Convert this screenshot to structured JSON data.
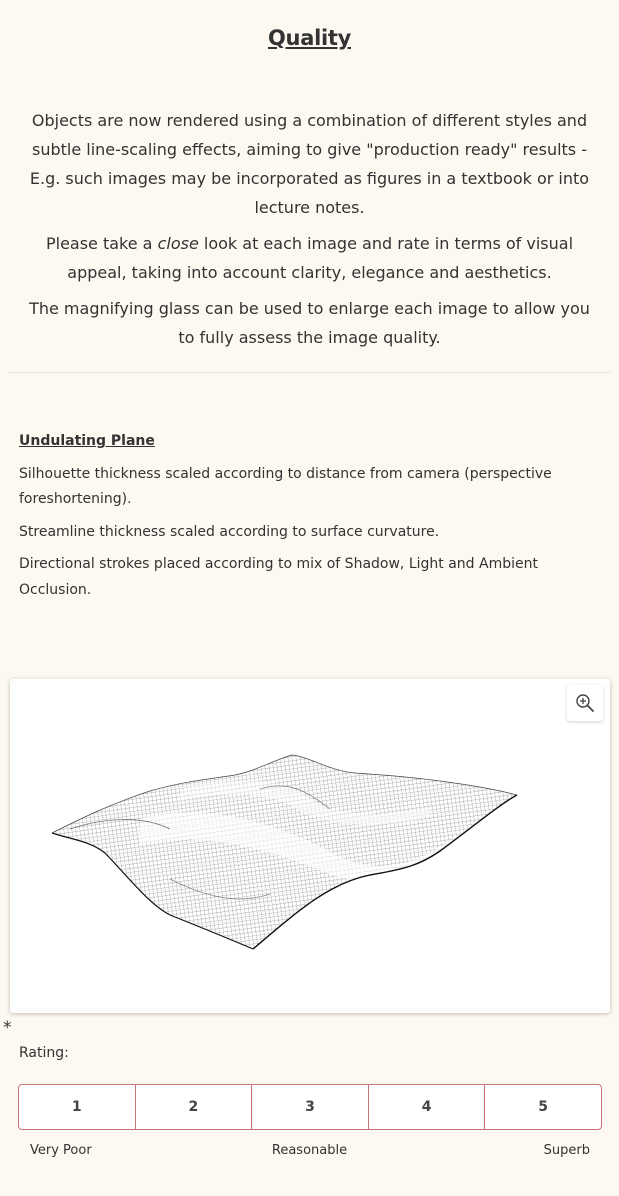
{
  "page": {
    "title": "Quality"
  },
  "intro": {
    "p1": "Objects are now rendered using a combination of different styles and subtle line-scaling effects, aiming to give \"production ready\" results - E.g. such images may be incorporated as figures in a textbook or into lecture notes.",
    "p2_before": "Please take a ",
    "p2_emphasis": "close",
    "p2_after": " look at each image and rate in terms of visual appeal, taking into account clarity, elegance and aesthetics.",
    "p3": "The magnifying glass can be used to enlarge each image to allow you to fully assess the image quality."
  },
  "section": {
    "title": "Undulating Plane",
    "lines": [
      "Silhouette thickness scaled according to distance from camera (perspective foreshortening).",
      "Streamline thickness scaled according to surface curvature.",
      "Directional strokes placed according to mix of Shadow, Light and Ambient Occlusion."
    ]
  },
  "image": {
    "zoom_icon": "zoom-in-icon"
  },
  "rating": {
    "required_mark": "*",
    "label": "Rating:",
    "options": [
      "1",
      "2",
      "3",
      "4",
      "5"
    ],
    "scale": {
      "low": "Very Poor",
      "mid": "Reasonable",
      "high": "Superb"
    }
  },
  "colors": {
    "background": "#fdf8f0",
    "rating_border": "#c9707a",
    "text": "#333333"
  }
}
